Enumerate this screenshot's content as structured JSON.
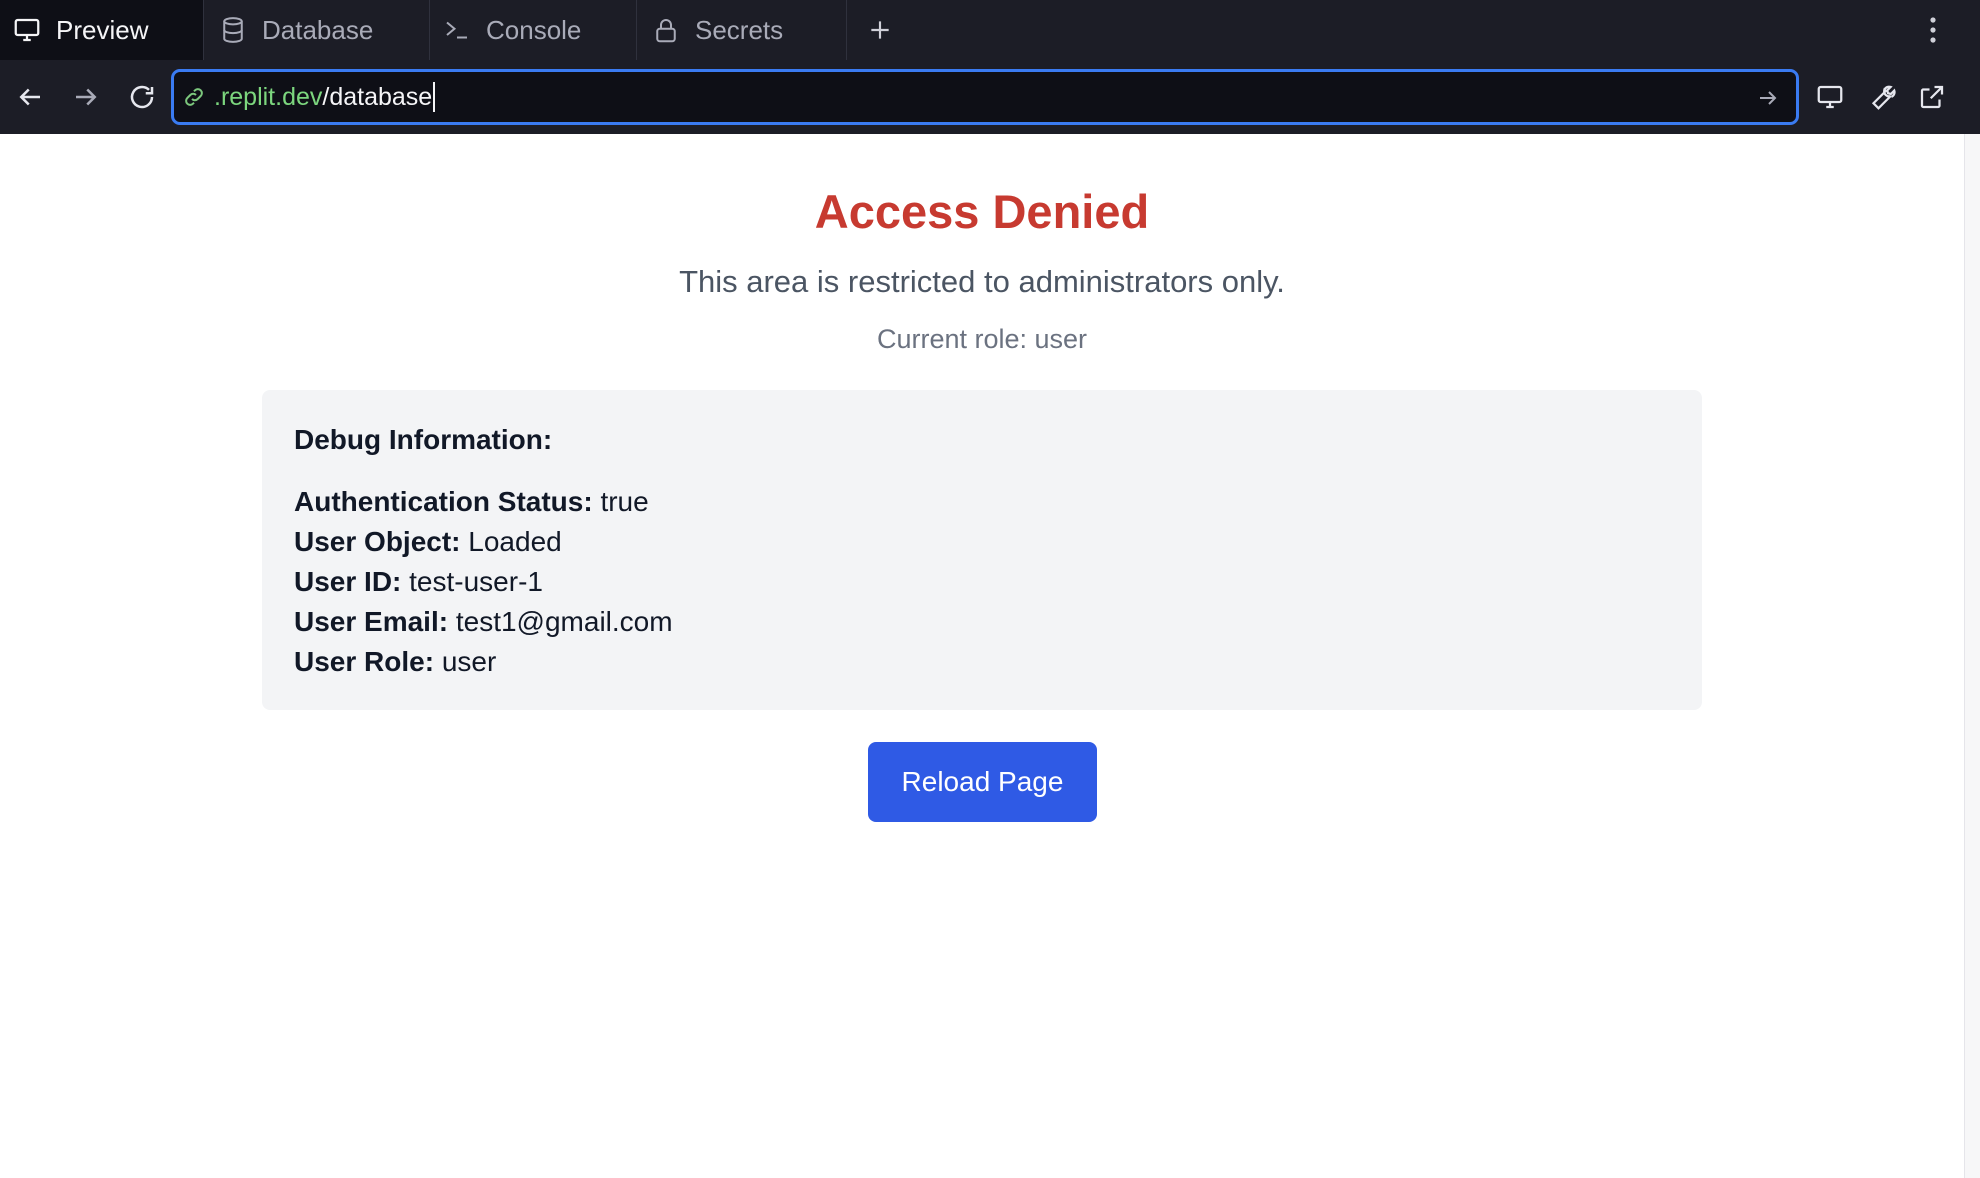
{
  "tabs": [
    {
      "label": "Preview",
      "icon": "monitor-icon",
      "active": true
    },
    {
      "label": "Database",
      "icon": "database-icon",
      "active": false
    },
    {
      "label": "Console",
      "icon": "terminal-icon",
      "active": false
    },
    {
      "label": "Secrets",
      "icon": "lock-icon",
      "active": false
    }
  ],
  "address": {
    "host": ".replit.dev",
    "path": "/database"
  },
  "main": {
    "title": "Access Denied",
    "subtitle": "This area is restricted to administrators only.",
    "role_line": "Current role: user",
    "debug": {
      "heading": "Debug Information:",
      "rows": [
        {
          "label": "Authentication Status:",
          "value": " true"
        },
        {
          "label": "User Object:",
          "value": " Loaded"
        },
        {
          "label": "User ID:",
          "value": " test-user-1"
        },
        {
          "label": "User Email:",
          "value": " test1@gmail.com"
        },
        {
          "label": "User Role:",
          "value": " user"
        }
      ]
    },
    "reload_label": "Reload Page"
  },
  "colors": {
    "title": "#c73a30",
    "button": "#2f5ae5",
    "url_focus": "#3a7bf2",
    "url_host": "#7cd67e"
  }
}
